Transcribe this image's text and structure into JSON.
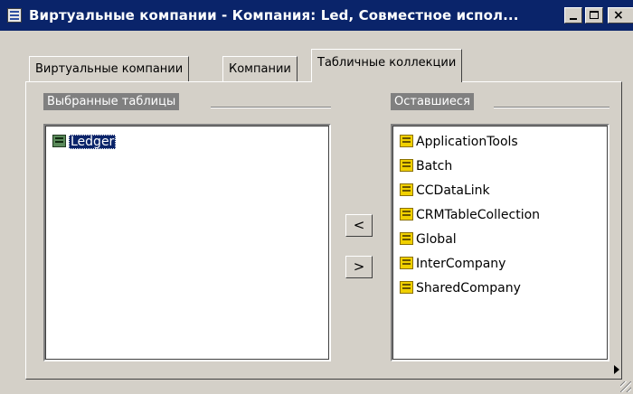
{
  "window": {
    "title": "Виртуальные компании - Компания: Led, Совместное испол...",
    "min_label": "",
    "max_label": "",
    "close_label": "×"
  },
  "tabs": [
    {
      "label": "Виртуальные компании",
      "active": false
    },
    {
      "label": "Компании",
      "active": false
    },
    {
      "label": "Табличные коллекции",
      "active": true
    }
  ],
  "selected_tables": {
    "label": "Выбранные таблицы",
    "items": [
      {
        "label": "Ledger",
        "icon": "green-table-icon",
        "selected": true
      }
    ]
  },
  "remaining": {
    "label": "Оставшиеся",
    "items": [
      {
        "label": "ApplicationTools",
        "icon": "yellow-table-icon"
      },
      {
        "label": "Batch",
        "icon": "yellow-table-icon"
      },
      {
        "label": "CCDataLink",
        "icon": "yellow-table-icon"
      },
      {
        "label": "CRMTableCollection",
        "icon": "yellow-table-icon"
      },
      {
        "label": "Global",
        "icon": "yellow-table-icon"
      },
      {
        "label": "InterCompany",
        "icon": "yellow-table-icon"
      },
      {
        "label": "SharedCompany",
        "icon": "yellow-table-icon"
      }
    ]
  },
  "buttons": {
    "move_left": "<",
    "move_right": ">"
  },
  "colors": {
    "face": "#d4d0c8",
    "title_bar": "#0a246a",
    "selection": "#0a246a"
  }
}
